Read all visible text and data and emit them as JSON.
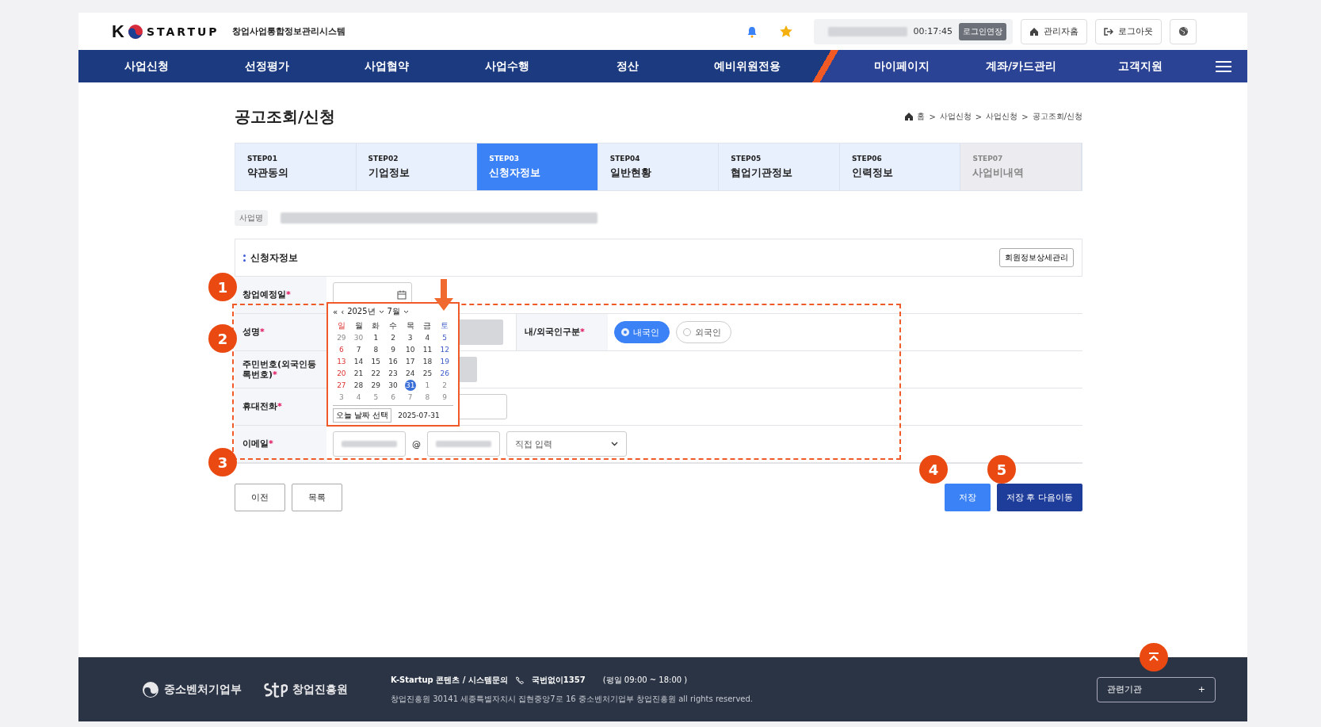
{
  "header": {
    "logo_mark": "K",
    "logo_text": "STARTUP",
    "system_name": "창업사업통합정보관리시스템",
    "session_time": "00:17:45",
    "extend_button": "로그인연장",
    "admin_home": "관리자홈",
    "logout": "로그아웃"
  },
  "nav": {
    "left": [
      "사업신청",
      "선정평가",
      "사업협약",
      "사업수행",
      "정산",
      "예비위원전용"
    ],
    "right": [
      "마이페이지",
      "계좌/카드관리",
      "고객지원"
    ]
  },
  "page_title": "공고조회/신청",
  "breadcrumb": [
    {
      "label": "홈"
    },
    {
      "sep": ">",
      "label": "사업신청"
    },
    {
      "sep": ">",
      "label": "사업신청"
    },
    {
      "sep": ">",
      "label": "공고조회/신청"
    }
  ],
  "steps": [
    {
      "step": "STEP01",
      "label": "약관동의",
      "selected": false,
      "disabled": false
    },
    {
      "step": "STEP02",
      "label": "기업정보",
      "selected": false,
      "disabled": false
    },
    {
      "step": "STEP03",
      "label": "신청자정보",
      "selected": true,
      "disabled": false
    },
    {
      "step": "STEP04",
      "label": "일반현황",
      "selected": false,
      "disabled": false
    },
    {
      "step": "STEP05",
      "label": "협업기관정보",
      "selected": false,
      "disabled": false
    },
    {
      "step": "STEP06",
      "label": "인력정보",
      "selected": false,
      "disabled": false
    },
    {
      "step": "STEP07",
      "label": "사업비내역",
      "selected": false,
      "disabled": true
    }
  ],
  "business_label": "사업명",
  "section": {
    "title": "신청자정보",
    "manage_button": "회원정보상세관리"
  },
  "form_rows": [
    {
      "kind": "date",
      "label": "창업예정일",
      "mark": "*"
    },
    {
      "kind": "name",
      "label": "성명",
      "mark": "*",
      "label2": "내/외국인구분",
      "mark2": "*",
      "options": [
        {
          "label": "내국인",
          "selected": true
        },
        {
          "label": "외국인",
          "selected": false
        }
      ]
    },
    {
      "kind": "block",
      "label": "주민번호(외국인등록번호)",
      "mark": "*"
    },
    {
      "kind": "phone",
      "label": "휴대전화",
      "mark": "*"
    },
    {
      "kind": "email",
      "label": "이메일",
      "mark": "*",
      "at": "@",
      "domain_select": "직접 입력"
    }
  ],
  "calendar": {
    "prev_year": "«",
    "prev_month": "‹",
    "year": "2025년",
    "month": "7월",
    "weekdays": [
      "일",
      "월",
      "화",
      "수",
      "목",
      "금",
      "토"
    ],
    "weeks": [
      [
        {
          "d": "29",
          "muted": true,
          "selected": false
        },
        {
          "d": "30",
          "muted": true,
          "selected": false
        },
        {
          "d": "1",
          "muted": false,
          "selected": false
        },
        {
          "d": "2",
          "muted": false,
          "selected": false
        },
        {
          "d": "3",
          "muted": false,
          "selected": false
        },
        {
          "d": "4",
          "muted": false,
          "selected": false
        },
        {
          "d": "5",
          "muted": false,
          "selected": false
        }
      ],
      [
        {
          "d": "6",
          "muted": false,
          "selected": false
        },
        {
          "d": "7",
          "muted": false,
          "selected": false
        },
        {
          "d": "8",
          "muted": false,
          "selected": false
        },
        {
          "d": "9",
          "muted": false,
          "selected": false
        },
        {
          "d": "10",
          "muted": false,
          "selected": false
        },
        {
          "d": "11",
          "muted": false,
          "selected": false
        },
        {
          "d": "12",
          "muted": false,
          "selected": false
        }
      ],
      [
        {
          "d": "13",
          "muted": false,
          "selected": false
        },
        {
          "d": "14",
          "muted": false,
          "selected": false
        },
        {
          "d": "15",
          "muted": false,
          "selected": false
        },
        {
          "d": "16",
          "muted": false,
          "selected": false
        },
        {
          "d": "17",
          "muted": false,
          "selected": false
        },
        {
          "d": "18",
          "muted": false,
          "selected": false
        },
        {
          "d": "19",
          "muted": false,
          "selected": false
        }
      ],
      [
        {
          "d": "20",
          "muted": false,
          "selected": false
        },
        {
          "d": "21",
          "muted": false,
          "selected": false
        },
        {
          "d": "22",
          "muted": false,
          "selected": false
        },
        {
          "d": "23",
          "muted": false,
          "selected": false
        },
        {
          "d": "24",
          "muted": false,
          "selected": false
        },
        {
          "d": "25",
          "muted": false,
          "selected": false
        },
        {
          "d": "26",
          "muted": false,
          "selected": false
        }
      ],
      [
        {
          "d": "27",
          "muted": false,
          "selected": false
        },
        {
          "d": "28",
          "muted": false,
          "selected": false
        },
        {
          "d": "29",
          "muted": false,
          "selected": false
        },
        {
          "d": "30",
          "muted": false,
          "selected": false
        },
        {
          "d": "31",
          "muted": false,
          "selected": true
        },
        {
          "d": "1",
          "muted": true,
          "selected": false
        },
        {
          "d": "2",
          "muted": true,
          "selected": false
        }
      ],
      [
        {
          "d": "3",
          "muted": true,
          "selected": false
        },
        {
          "d": "4",
          "muted": true,
          "selected": false
        },
        {
          "d": "5",
          "muted": true,
          "selected": false
        },
        {
          "d": "6",
          "muted": true,
          "selected": false
        },
        {
          "d": "7",
          "muted": true,
          "selected": false
        },
        {
          "d": "8",
          "muted": true,
          "selected": false
        },
        {
          "d": "9",
          "muted": true,
          "selected": false
        }
      ]
    ],
    "today_button": "오늘 날짜 선택",
    "today_value": "2025-07-31"
  },
  "buttons_left": [
    "이전",
    "목록"
  ],
  "buttons_right": [
    {
      "label": "저장",
      "kind": "save"
    },
    {
      "label": "저장 후 다음이동",
      "kind": "next"
    }
  ],
  "annotations": [
    "1",
    "2",
    "3",
    "4",
    "5"
  ],
  "footer": {
    "ministry": "중소벤처기업부",
    "agency": "창업진흥원",
    "contact_title": "K-Startup 콘텐츠 / 시스템문의",
    "phone": "국번없이1357",
    "hours": "(평일 09:00 ~ 18:00 )",
    "address": "창업진흥원 30141 세종특별자치시 집현중앙7로 16 중소벤처기업부 창업진흥원 all rights reserved.",
    "related": "관련기관",
    "plus": "+"
  }
}
